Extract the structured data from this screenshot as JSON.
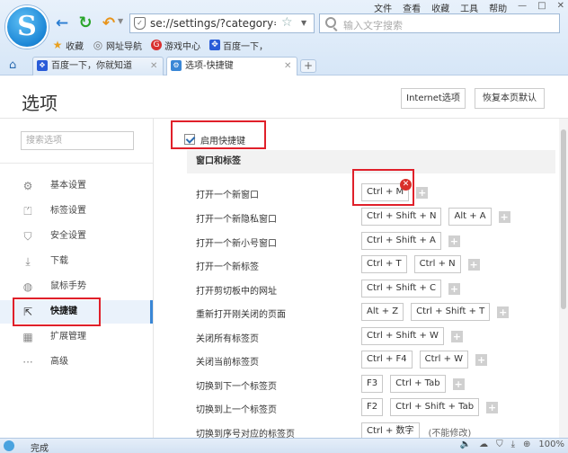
{
  "browser": {
    "logo_letter": "S",
    "address_url": "se://settings/?category=sho",
    "search_placeholder": "输入文字搜索",
    "menu": [
      "文件",
      "查看",
      "收藏",
      "工具",
      "帮助"
    ],
    "window_controls": [
      "—",
      "□",
      "✕"
    ],
    "favorites": [
      {
        "label": "收藏",
        "icon": "star-icon",
        "color": "#e8a020"
      },
      {
        "label": "网址导航",
        "icon": "globe-icon",
        "color": "#777777"
      },
      {
        "label": "游戏中心",
        "icon": "game-icon",
        "color": "#d83030"
      },
      {
        "label": "百度一下，",
        "icon": "baidu-icon",
        "color": "#2a5cd8"
      }
    ],
    "tabs": [
      {
        "title": "百度一下，你就知道",
        "icon_color": "#2a5cd8",
        "active": false
      },
      {
        "title": "选项-快捷键",
        "icon_color": "#3a87d6",
        "active": true
      }
    ],
    "new_tab": "+"
  },
  "page": {
    "title": "选项",
    "btn_ie": "Internet选项",
    "btn_reset": "恢复本页默认",
    "search_placeholder": "搜索选项"
  },
  "sidebar": {
    "items": [
      {
        "label": "基本设置",
        "icon": "gear-icon",
        "glyph": "⚙",
        "active": false
      },
      {
        "label": "标签设置",
        "icon": "tab-icon",
        "glyph": "⏍",
        "active": false
      },
      {
        "label": "安全设置",
        "icon": "shield-icon",
        "glyph": "⛉",
        "active": false
      },
      {
        "label": "下载",
        "icon": "download-icon",
        "glyph": "⤓",
        "active": false
      },
      {
        "label": "鼠标手势",
        "icon": "mouse-icon",
        "glyph": "◍",
        "active": false
      },
      {
        "label": "快捷键",
        "icon": "shortcut-icon",
        "glyph": "⇱",
        "active": true
      },
      {
        "label": "扩展管理",
        "icon": "extension-icon",
        "glyph": "▦",
        "active": false
      },
      {
        "label": "高级",
        "icon": "more-icon",
        "glyph": "···",
        "active": false
      }
    ]
  },
  "shortcuts": {
    "enable_label": "启用快捷键",
    "enabled": true,
    "group_title": "窗口和标签",
    "rows": [
      {
        "action": "打开一个新窗口",
        "keys": [
          "Ctrl + M"
        ],
        "delete_badge": true
      },
      {
        "action": "打开一个新隐私窗口",
        "keys": [
          "Ctrl + Shift + N",
          "Alt + A"
        ]
      },
      {
        "action": "打开一个新小号窗口",
        "keys": [
          "Ctrl + Shift + A"
        ]
      },
      {
        "action": "打开一个新标签",
        "keys": [
          "Ctrl + T",
          "Ctrl + N"
        ]
      },
      {
        "action": "打开剪切板中的网址",
        "keys": [
          "Ctrl + Shift + C"
        ]
      },
      {
        "action": "重新打开刚关闭的页面",
        "keys": [
          "Alt + Z",
          "Ctrl + Shift + T"
        ]
      },
      {
        "action": "关闭所有标签页",
        "keys": [
          "Ctrl + Shift + W"
        ]
      },
      {
        "action": "关闭当前标签页",
        "keys": [
          "Ctrl + F4",
          "Ctrl + W"
        ]
      },
      {
        "action": "切换到下一个标签页",
        "keys": [
          "F3",
          "Ctrl + Tab"
        ]
      },
      {
        "action": "切换到上一个标签页",
        "keys": [
          "F2",
          "Ctrl + Shift + Tab"
        ]
      },
      {
        "action": "切换到序号对应的标签页",
        "keys": [
          "Ctrl + 数字"
        ],
        "note": "(不能修改)",
        "no_plus": true
      }
    ]
  },
  "status": {
    "text": "完成",
    "zoom": "100%"
  },
  "colors": {
    "accent": "#3a87d6",
    "highlight_box": "#e0202a",
    "delete_badge": "#d9302a"
  }
}
